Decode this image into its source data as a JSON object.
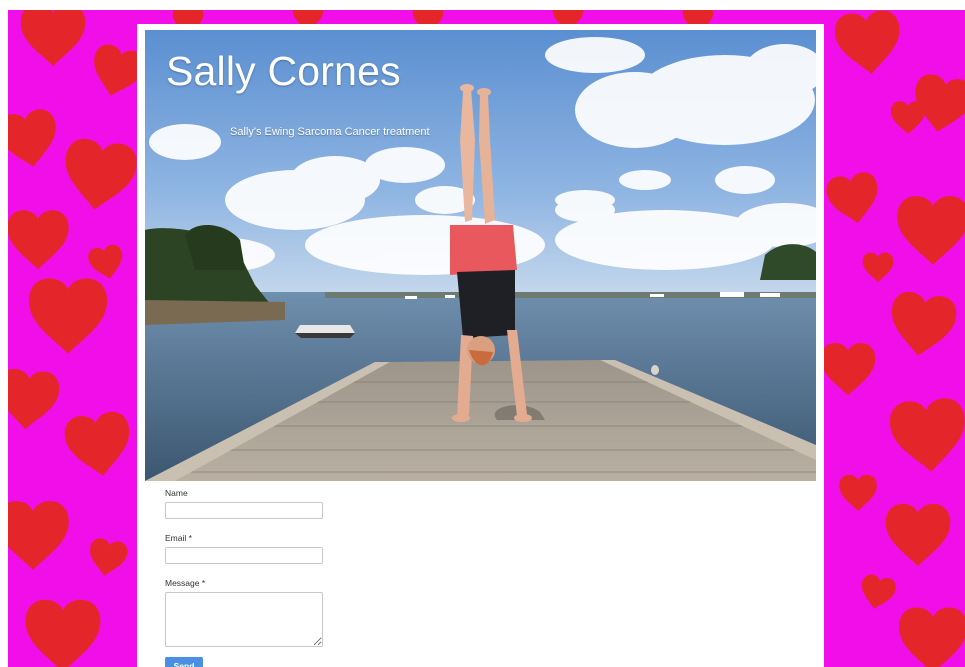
{
  "site": {
    "title": "Sally Cornes",
    "tagline": "Sally's Ewing Sarcoma Cancer treatment"
  },
  "hero": {
    "image_description_icon": "handstand-on-jetty-photo"
  },
  "form": {
    "name_label": "Name",
    "name_value": "",
    "email_label": "Email *",
    "email_value": "",
    "message_label": "Message *",
    "message_value": "",
    "send_label": "Send"
  },
  "colors": {
    "background": "#f20ee8",
    "heart": "#e4262a",
    "card": "#ffffff",
    "button": "#4a90e2"
  }
}
